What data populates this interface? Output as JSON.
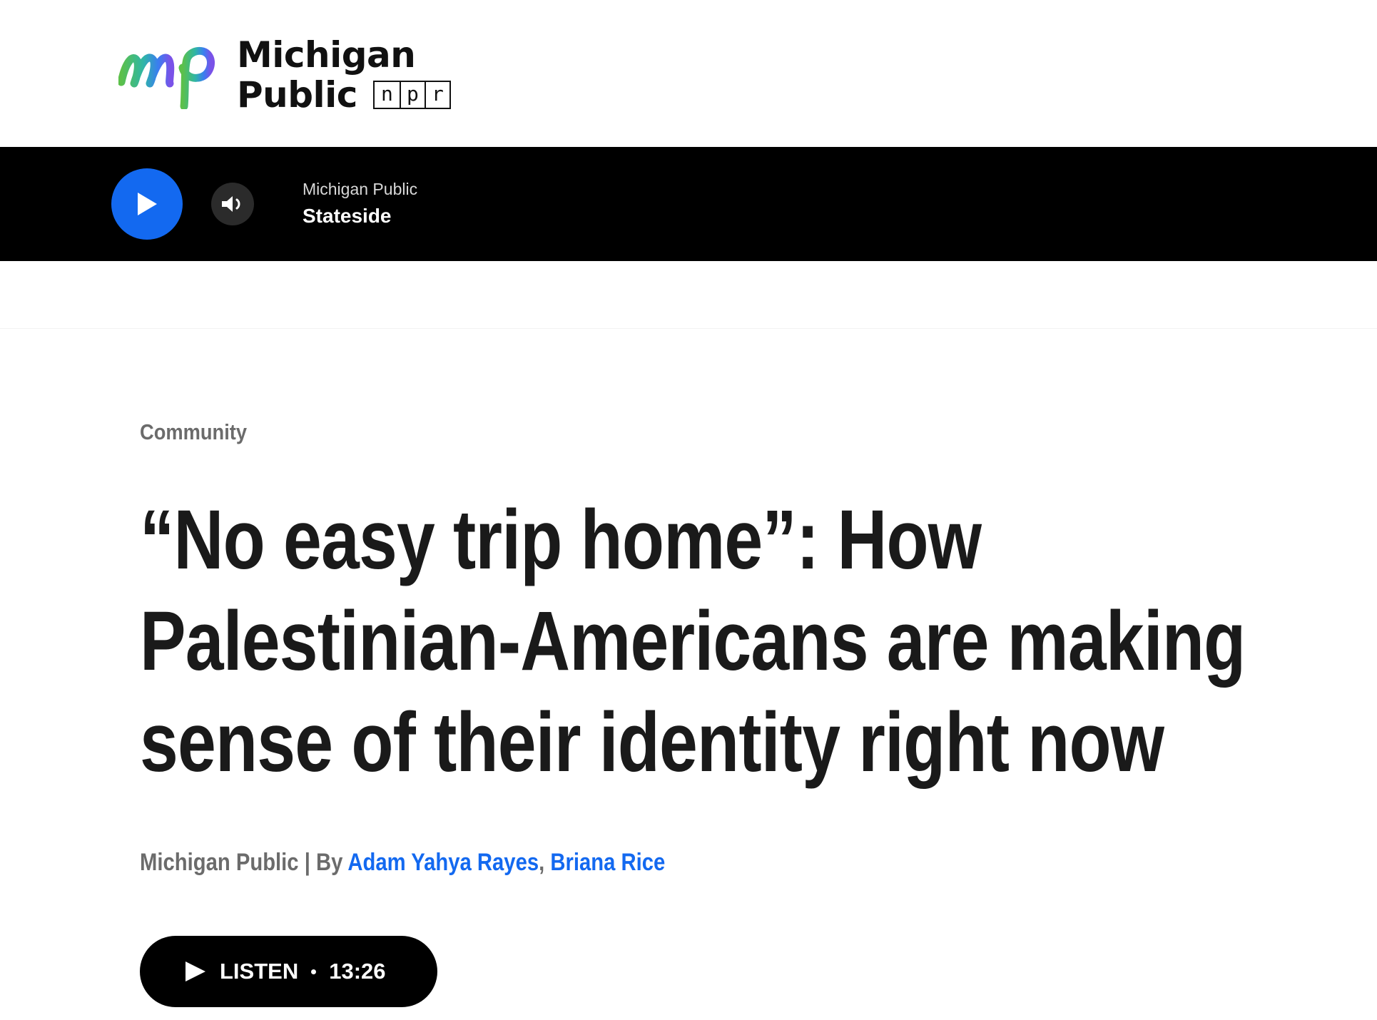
{
  "site": {
    "logo_line1": "Michigan",
    "logo_line2": "Public",
    "npr_letters": [
      "n",
      "p",
      "r"
    ],
    "logo_icon": "mp-logo-icon"
  },
  "player": {
    "play_icon": "play-icon",
    "volume_icon": "volume-icon",
    "station_name": "Michigan Public",
    "show_name": "Stateside",
    "accent_color": "#1369f0"
  },
  "article": {
    "category": "Community",
    "headline": "“No easy trip home”: How Palestinian-Americans are making sense of their identity right now",
    "byline": {
      "source": "Michigan Public",
      "separator": " | ",
      "by": "By ",
      "authors": [
        "Adam Yahya Rayes",
        "Briana Rice"
      ],
      "author_separator": ", "
    },
    "listen": {
      "label": "LISTEN",
      "duration": "13:26"
    }
  }
}
